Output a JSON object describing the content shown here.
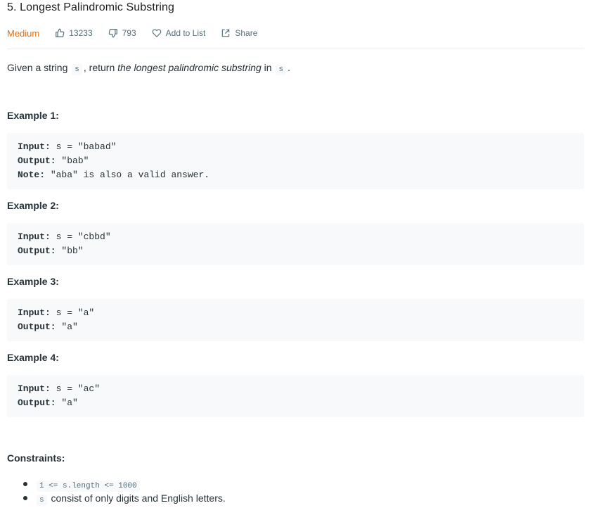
{
  "problem": {
    "title": "5. Longest Palindromic Substring",
    "difficulty": "Medium",
    "likes": "13233",
    "dislikes": "793",
    "add_to_list": "Add to List",
    "share": "Share",
    "accent_color": "#ef6c00"
  },
  "description": {
    "part1": "Given a string ",
    "code1": "s",
    "part2": ", return ",
    "italic": "the longest palindromic substring",
    "part3": " in ",
    "code2": "s",
    "part4": "."
  },
  "examples": [
    {
      "title": "Example 1:",
      "input_label": "Input:",
      "input": " s = \"babad\"",
      "output_label": "Output:",
      "output": " \"bab\"",
      "note_label": "Note:",
      "note": " \"aba\" is also a valid answer."
    },
    {
      "title": "Example 2:",
      "input_label": "Input:",
      "input": " s = \"cbbd\"",
      "output_label": "Output:",
      "output": " \"bb\""
    },
    {
      "title": "Example 3:",
      "input_label": "Input:",
      "input": " s = \"a\"",
      "output_label": "Output:",
      "output": " \"a\""
    },
    {
      "title": "Example 4:",
      "input_label": "Input:",
      "input": " s = \"ac\"",
      "output_label": "Output:",
      "output": " \"a\""
    }
  ],
  "constraints": {
    "title": "Constraints:",
    "items": [
      {
        "code": "1 <= s.length <= 1000",
        "text": ""
      },
      {
        "code": "s",
        "text": " consist of only digits and English letters."
      }
    ]
  }
}
